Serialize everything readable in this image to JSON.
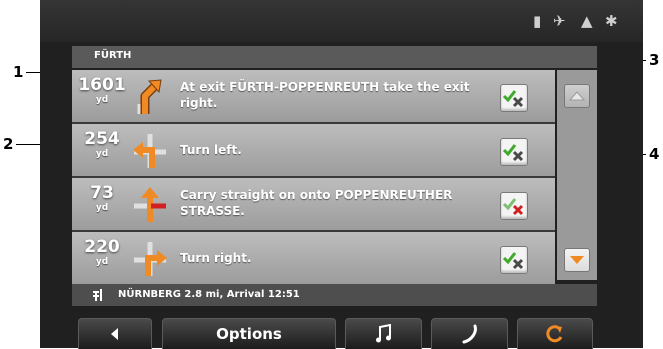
{
  "callouts": [
    "1",
    "2",
    "3",
    "4"
  ],
  "status_icons": [
    "battery-icon",
    "tmc-icon",
    "warning-icon",
    "gps-icon"
  ],
  "header": {
    "city": "FÜRTH"
  },
  "rows": [
    {
      "distance": "1601",
      "unit": "yd",
      "instruction": "At exit FÜRTH-POPPENREUTH take the exit right.",
      "arrow": "exit-right",
      "checked": true
    },
    {
      "distance": "254",
      "unit": "yd",
      "instruction": "Turn left.",
      "arrow": "turn-left",
      "checked": true
    },
    {
      "distance": "73",
      "unit": "yd",
      "instruction": "Carry straight on onto POPPENREUTHER STRASSE.",
      "arrow": "straight",
      "checked": false
    },
    {
      "distance": "220",
      "unit": "yd",
      "instruction": "Turn right.",
      "arrow": "turn-right",
      "checked": true
    }
  ],
  "footer": {
    "destination": "NÜRNBERG 2.8 mi, Arrival 12:51"
  },
  "buttons": {
    "options": "Options"
  },
  "colors": {
    "accent_orange": "#f08a24",
    "check_green": "#3faa2b",
    "cross_red": "#d21f1f",
    "cross_gray": "#4a4a4a"
  }
}
